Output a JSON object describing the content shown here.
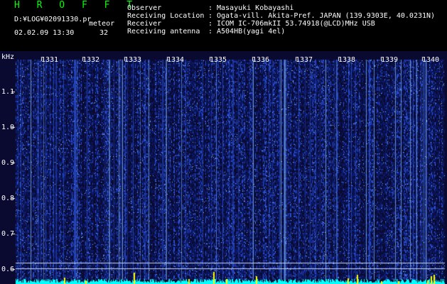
{
  "header": {
    "app_title": "H R O F F T",
    "file_path": "D:¥LOG¥02091330.pr",
    "tag": "meteor",
    "datetime": "02.02.09 13:30",
    "count": "32",
    "meta_sep": ":",
    "meta": [
      {
        "key": "Observer",
        "value": "Masayuki Kobayashi"
      },
      {
        "key": "Receiving Location",
        "value": "Ogata-vill. Akita-Pref. JAPAN (139.9303E, 40.0231N)"
      },
      {
        "key": "Receiver",
        "value": "ICOM IC-706mkII 53.74918(@LCD)MHz USB"
      },
      {
        "key": "Receiving antenna",
        "value": "A504HB(yagi 4el)"
      }
    ]
  },
  "spectrogram": {
    "y_unit": "kHz",
    "y_ticks": [
      "1.1",
      "1.0",
      "0.9",
      "0.8",
      "0.7",
      "0.6"
    ],
    "minute_labels": [
      "1331",
      "1332",
      "1333",
      "1334",
      "1335",
      "1336",
      "1337",
      "1338",
      "1339",
      "1340"
    ],
    "colors": {
      "background": "#0a0a30",
      "noise_dark": "#0b1a6e",
      "noise_bright": "#2a4fd0",
      "streak": "#7fb8ff",
      "echo_line": "#c8d8ff",
      "baseline_trace": "#00ffff",
      "spikes": "#ffff00"
    }
  }
}
